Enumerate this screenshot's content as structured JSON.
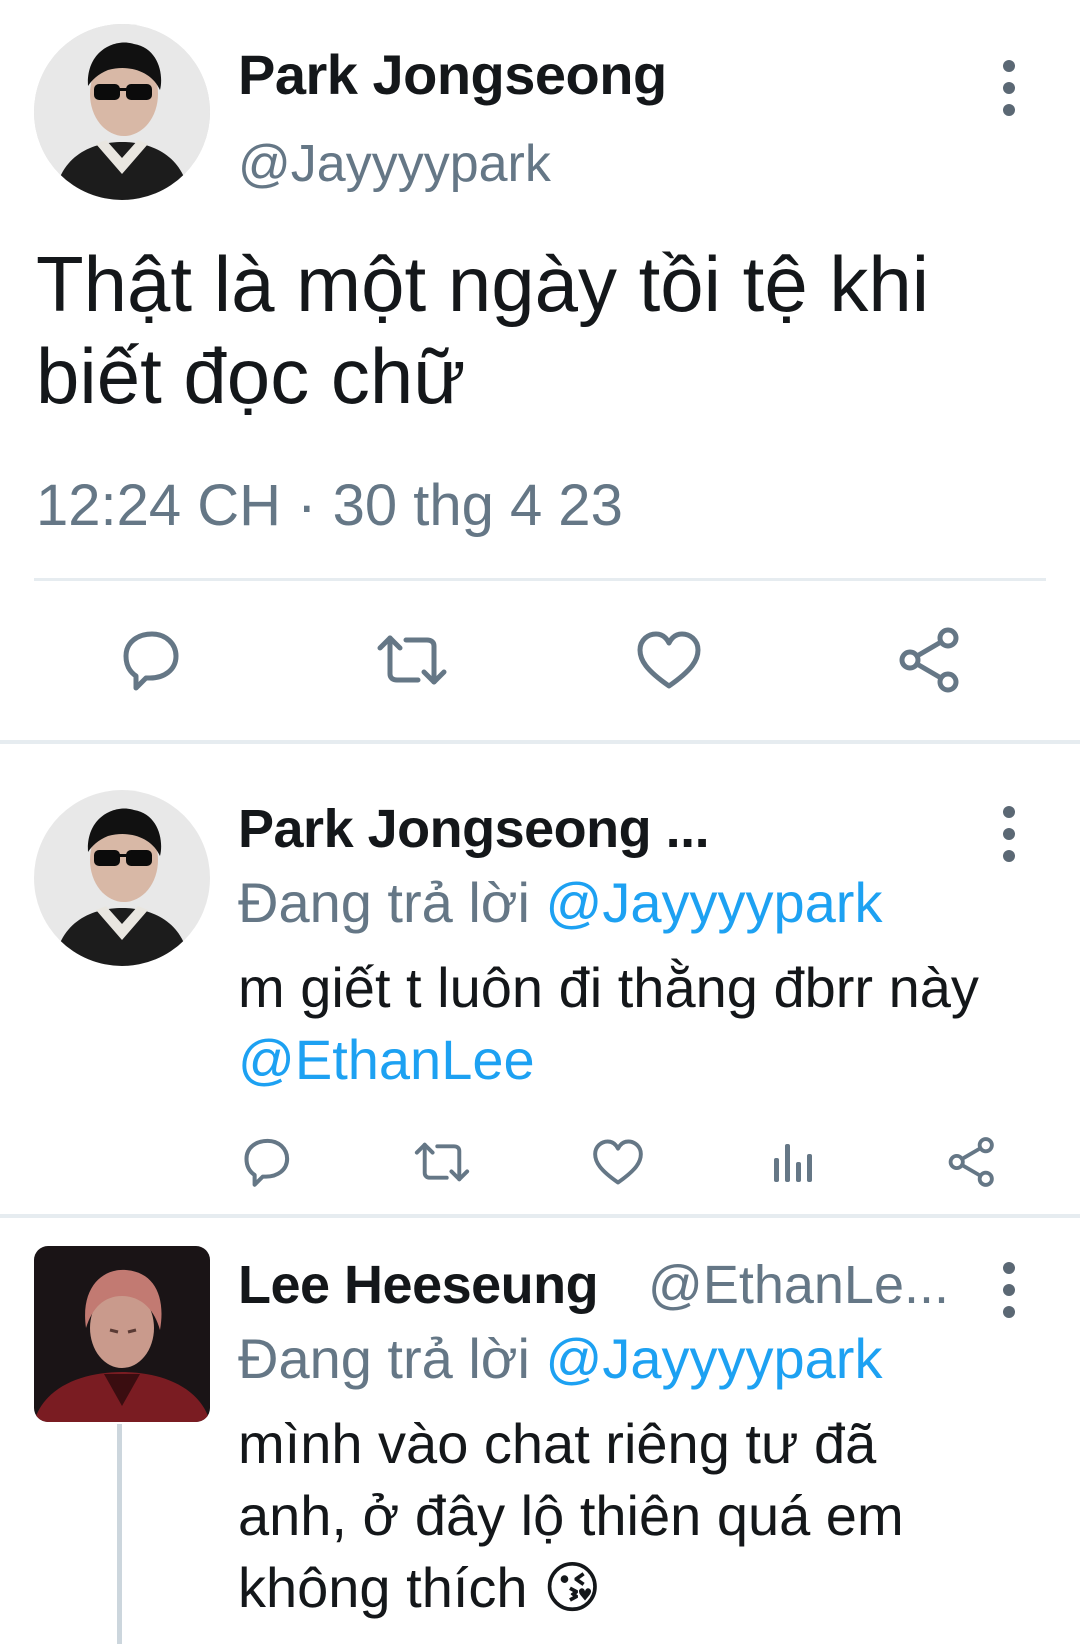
{
  "main_tweet": {
    "author_name": "Park Jongseong",
    "handle": "@Jayyyypark",
    "text": "Thật là một ngày tồi tệ khi biết đọc chữ",
    "timestamp": "12:24 CH · 30 thg 4 23"
  },
  "reply1": {
    "author_name": "Park Jongseong ...",
    "replying_label": "Đang trả lời",
    "replying_to": "@Jayyyypark",
    "text_part1": "m giết t luôn đi thằng đbrr này",
    "mention": "@EthanLee"
  },
  "reply2": {
    "author_name": "Lee Heeseung",
    "handle": "@EthanLe...",
    "replying_label": "Đang trả lời",
    "replying_to": "@Jayyyypark",
    "text": "mình vào chat riêng tư đã anh, ở đây lộ thiên quá em không thích",
    "emoji": "😘"
  },
  "icons": {
    "reply": "reply-icon",
    "retweet": "retweet-icon",
    "like": "like-icon",
    "share": "share-icon",
    "views": "views-icon",
    "more": "more-options-icon"
  },
  "colors": {
    "text": "#14171a",
    "secondary": "#657786",
    "accent": "#1da1f2",
    "divider": "#e6ecf0"
  }
}
